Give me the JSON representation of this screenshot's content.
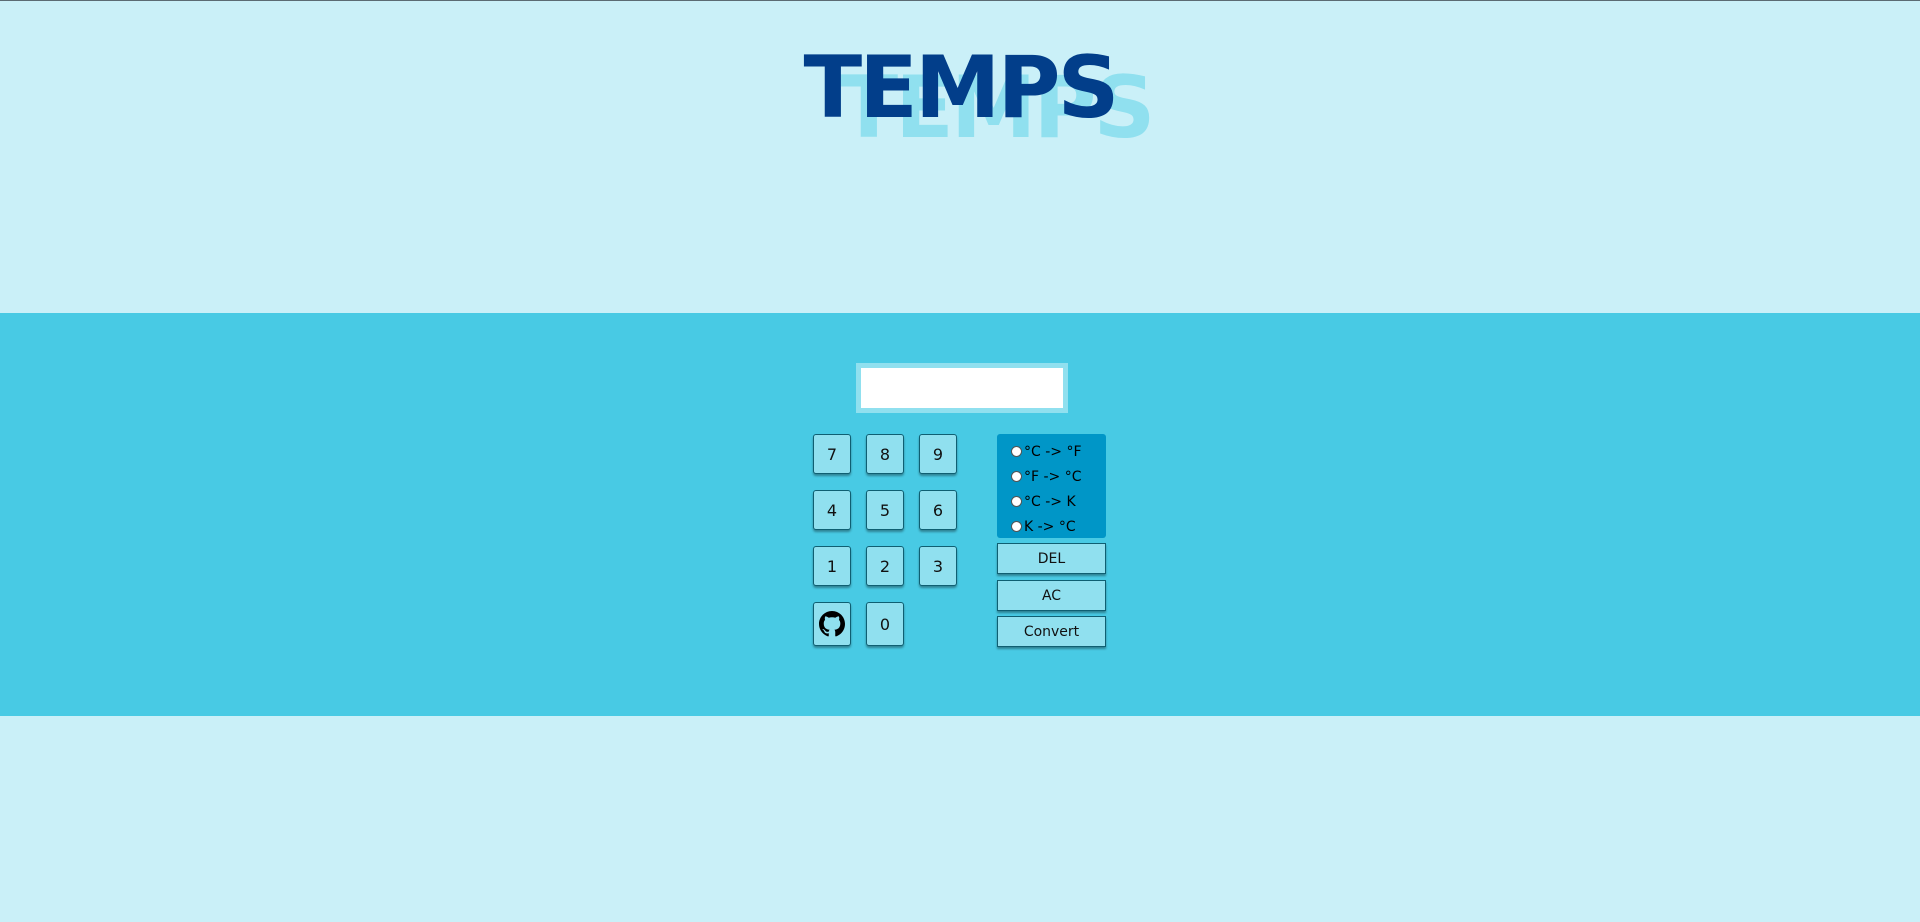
{
  "header": {
    "title": "TEMPS",
    "title_shadow": "TEMPS"
  },
  "display": {
    "value": "",
    "placeholder": ""
  },
  "keypad": {
    "keys": [
      "7",
      "8",
      "9",
      "4",
      "5",
      "6",
      "1",
      "2",
      "3",
      "0"
    ],
    "github_icon": "github-icon"
  },
  "conversions": {
    "options": [
      "°C -> °F",
      "°F -> °C",
      "°C -> K",
      "K -> °C"
    ]
  },
  "actions": {
    "del_label": "DEL",
    "ac_label": "AC",
    "convert_label": "Convert"
  },
  "colors": {
    "page_background": "#caf0f8",
    "band_background": "#48cae4",
    "title_main": "#023e8a",
    "title_shadow": "#90e0ef",
    "key_background": "#90e0ef",
    "radio_panel": "#0096c7"
  }
}
